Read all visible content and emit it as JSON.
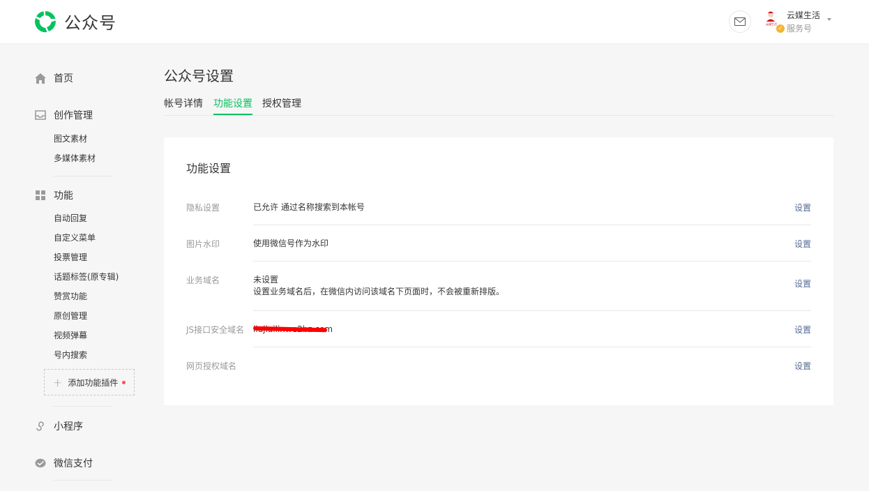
{
  "header": {
    "title": "公众号",
    "account_name": "云媒生活",
    "account_type": "服务号",
    "avatar_text": "云媒生活"
  },
  "sidebar": {
    "home": "首页",
    "creation": "创作管理",
    "creation_items": [
      "图文素材",
      "多媒体素材"
    ],
    "features": "功能",
    "feature_items": [
      "自动回复",
      "自定义菜单",
      "投票管理",
      "话题标签(原专辑)",
      "赞赏功能",
      "原创管理",
      "视频弹幕",
      "号内搜索"
    ],
    "add_plugin": "添加功能插件",
    "mini_program": "小程序",
    "wechat_pay": "微信支付"
  },
  "main": {
    "title": "公众号设置",
    "tabs": [
      "帐号详情",
      "功能设置",
      "授权管理"
    ],
    "active_tab": "功能设置"
  },
  "card": {
    "title": "功能设置",
    "action_label": "设置",
    "rows": [
      {
        "label": "隐私设置",
        "value": "已允许 通过名称搜索到本帐号",
        "note": ""
      },
      {
        "label": "图片水印",
        "value": "使用微信号作为水印",
        "note": ""
      },
      {
        "label": "业务域名",
        "value": "未设置",
        "note": "设置业务域名后，在微信内访问该域名下页面时，不会被重新排版。"
      },
      {
        "label": "JS接口安全域名",
        "value": "liujiailinwe2bz.com",
        "note": ""
      },
      {
        "label": "网页授权域名",
        "value": "",
        "note": ""
      }
    ]
  },
  "colors": {
    "brand_green": "#07c160",
    "link_blue": "#576b95",
    "redaction_red": "#ff0000",
    "notification_dot": "#fa5151"
  }
}
